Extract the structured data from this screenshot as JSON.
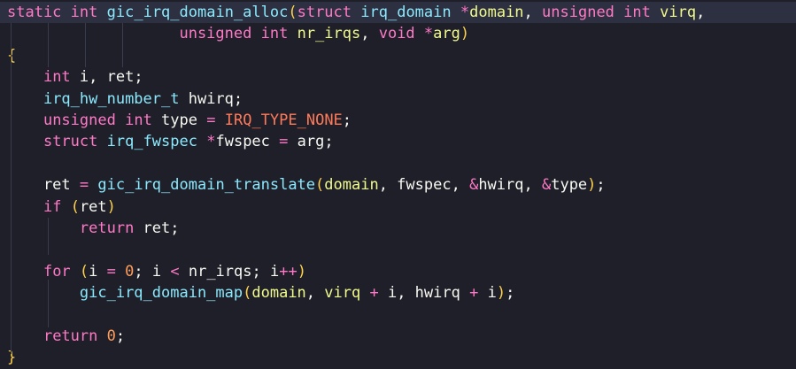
{
  "editor": {
    "lines": [
      [
        [
          "kw",
          "static"
        ],
        [
          "punc",
          " "
        ],
        [
          "kw",
          "int"
        ],
        [
          "punc",
          " "
        ],
        [
          "fn",
          "gic_irq_domain_alloc"
        ],
        [
          "p",
          "("
        ],
        [
          "kw",
          "struct"
        ],
        [
          "punc",
          " "
        ],
        [
          "fn",
          "irq_domain"
        ],
        [
          "punc",
          " "
        ],
        [
          "op",
          "*"
        ],
        [
          "vr",
          "domain"
        ],
        [
          "punc",
          ", "
        ],
        [
          "kw",
          "unsigned"
        ],
        [
          "punc",
          " "
        ],
        [
          "kw",
          "int"
        ],
        [
          "punc",
          " "
        ],
        [
          "vr",
          "virq"
        ],
        [
          "punc",
          ","
        ]
      ],
      [
        [
          "punc",
          "                   "
        ],
        [
          "kw",
          "unsigned"
        ],
        [
          "punc",
          " "
        ],
        [
          "kw",
          "int"
        ],
        [
          "punc",
          " "
        ],
        [
          "vr",
          "nr_irqs"
        ],
        [
          "punc",
          ", "
        ],
        [
          "kw",
          "void"
        ],
        [
          "punc",
          " "
        ],
        [
          "op",
          "*"
        ],
        [
          "vr",
          "arg"
        ],
        [
          "p",
          ")"
        ]
      ],
      [
        [
          "p",
          "{"
        ]
      ],
      [
        [
          "punc",
          "    "
        ],
        [
          "kw",
          "int"
        ],
        [
          "punc",
          " i, ret;"
        ]
      ],
      [
        [
          "punc",
          "    "
        ],
        [
          "fn",
          "irq_hw_number_t"
        ],
        [
          "punc",
          " hwirq;"
        ]
      ],
      [
        [
          "punc",
          "    "
        ],
        [
          "kw",
          "unsigned"
        ],
        [
          "punc",
          " "
        ],
        [
          "kw",
          "int"
        ],
        [
          "punc",
          " type "
        ],
        [
          "op",
          "="
        ],
        [
          "punc",
          " "
        ],
        [
          "cst",
          "IRQ_TYPE_NONE"
        ],
        [
          "punc",
          ";"
        ]
      ],
      [
        [
          "punc",
          "    "
        ],
        [
          "kw",
          "struct"
        ],
        [
          "punc",
          " "
        ],
        [
          "fn",
          "irq_fwspec"
        ],
        [
          "punc",
          " "
        ],
        [
          "op",
          "*"
        ],
        [
          "punc",
          "fwspec "
        ],
        [
          "op",
          "="
        ],
        [
          "punc",
          " arg;"
        ]
      ],
      [],
      [
        [
          "punc",
          "    ret "
        ],
        [
          "op",
          "="
        ],
        [
          "punc",
          " "
        ],
        [
          "fn",
          "gic_irq_domain_translate"
        ],
        [
          "p",
          "("
        ],
        [
          "vr",
          "domain"
        ],
        [
          "punc",
          ", fwspec, "
        ],
        [
          "op",
          "&"
        ],
        [
          "punc",
          "hwirq, "
        ],
        [
          "op",
          "&"
        ],
        [
          "punc",
          "type"
        ],
        [
          "p",
          ")"
        ],
        [
          "punc",
          ";"
        ]
      ],
      [
        [
          "punc",
          "    "
        ],
        [
          "kw",
          "if"
        ],
        [
          "punc",
          " "
        ],
        [
          "p",
          "("
        ],
        [
          "punc",
          "ret"
        ],
        [
          "p",
          ")"
        ]
      ],
      [
        [
          "punc",
          "        "
        ],
        [
          "kw",
          "return"
        ],
        [
          "punc",
          " ret;"
        ]
      ],
      [],
      [
        [
          "punc",
          "    "
        ],
        [
          "kw",
          "for"
        ],
        [
          "punc",
          " "
        ],
        [
          "p",
          "("
        ],
        [
          "punc",
          "i "
        ],
        [
          "op",
          "="
        ],
        [
          "punc",
          " "
        ],
        [
          "num",
          "0"
        ],
        [
          "punc",
          "; i "
        ],
        [
          "op",
          "<"
        ],
        [
          "punc",
          " nr_irqs; i"
        ],
        [
          "op",
          "++"
        ],
        [
          "p",
          ")"
        ]
      ],
      [
        [
          "punc",
          "        "
        ],
        [
          "fn",
          "gic_irq_domain_map"
        ],
        [
          "p",
          "("
        ],
        [
          "vr",
          "domain"
        ],
        [
          "punc",
          ", "
        ],
        [
          "vr",
          "virq"
        ],
        [
          "punc",
          " "
        ],
        [
          "op",
          "+"
        ],
        [
          "punc",
          " i, hwirq "
        ],
        [
          "op",
          "+"
        ],
        [
          "punc",
          " i"
        ],
        [
          "p",
          ")"
        ],
        [
          "punc",
          ";"
        ]
      ],
      [],
      [
        [
          "punc",
          "    "
        ],
        [
          "kw",
          "return"
        ],
        [
          "punc",
          " "
        ],
        [
          "num",
          "0"
        ],
        [
          "punc",
          ";"
        ]
      ],
      [
        [
          "p",
          "}"
        ]
      ]
    ]
  }
}
